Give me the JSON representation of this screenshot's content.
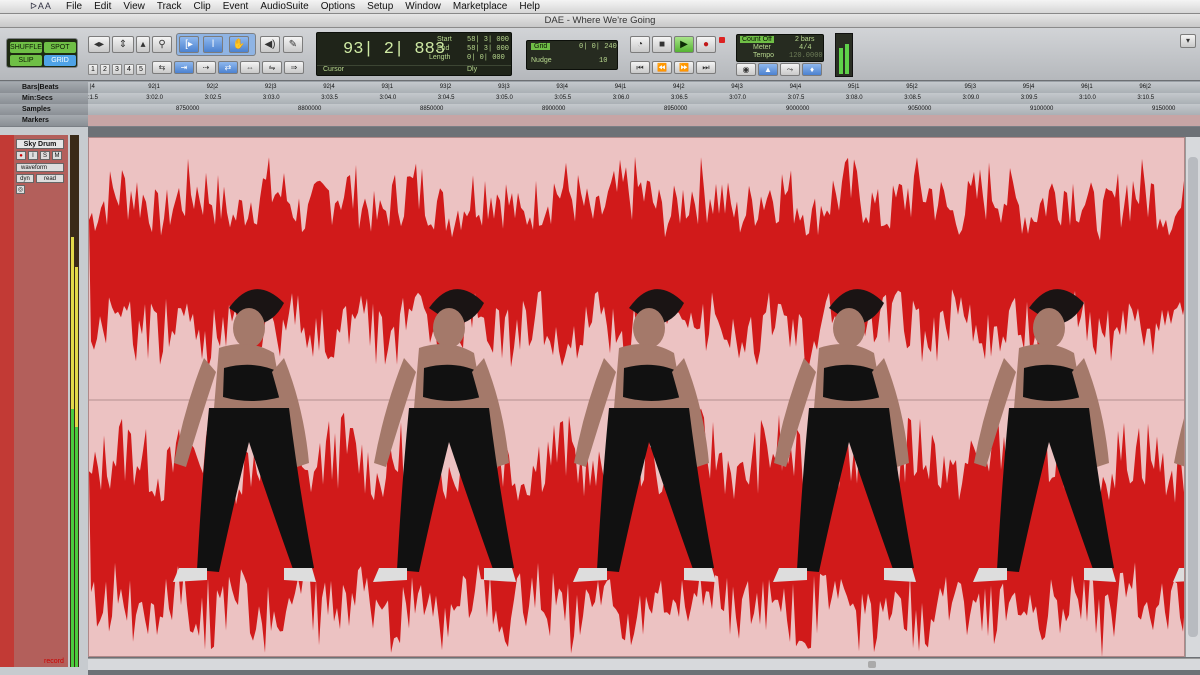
{
  "menubar": {
    "logo": "ᐅAA",
    "items": [
      "File",
      "Edit",
      "View",
      "Track",
      "Clip",
      "Event",
      "AudioSuite",
      "Options",
      "Setup",
      "Window",
      "Marketplace",
      "Help"
    ]
  },
  "window": {
    "title": "DAE - Where We're Going"
  },
  "edit_modes": {
    "shuffle": "SHUFFLE",
    "spot": "SPOT",
    "slip": "SLIP",
    "grid": "GRID"
  },
  "zoom_presets": [
    "1",
    "2",
    "3",
    "4",
    "5"
  ],
  "counter": {
    "main": "93| 2| 883",
    "start_label": "Start",
    "start_value": "58| 3| 000",
    "end_label": "End",
    "end_value": "58| 3| 000",
    "length_label": "Length",
    "length_value": "0| 0| 000",
    "cursor_label": "Cursor",
    "dly_label": "Dly"
  },
  "grid": {
    "grid_label": "Grid",
    "grid_value": "0| 0| 240",
    "nudge_label": "Nudge",
    "nudge_value": "10"
  },
  "midi": {
    "count_off": "Count Off",
    "count_off_value": "2 bars",
    "meter": "Meter",
    "meter_value": "4/4",
    "tempo": "Tempo",
    "tempo_value": "120.0000"
  },
  "rulers": {
    "bars_label": "Bars|Beats",
    "minsecs_label": "Min:Secs",
    "samples_label": "Samples",
    "markers_label": "Markers",
    "bars_ticks": [
      "|4",
      "92|1",
      "92|2",
      "92|3",
      "92|4",
      "93|1",
      "93|2",
      "93|3",
      "93|4",
      "94|1",
      "94|2",
      "94|3",
      "94|4",
      "95|1",
      "95|2",
      "95|3",
      "95|4",
      "96|1",
      "96|2"
    ],
    "min_ticks": [
      ":1.5",
      "3:02.0",
      "3:02.5",
      "3:03.0",
      "3:03.5",
      "3:04.0",
      "3:04.5",
      "3:05.0",
      "3:05.5",
      "3:06.0",
      "3:06.5",
      "3:07.0",
      "3:07.5",
      "3:08.0",
      "3:08.5",
      "3:09.0",
      "3:09.5",
      "3:10.0",
      "3:10.5"
    ],
    "sample_ticks": [
      "8750000",
      "8800000",
      "8850000",
      "8900000",
      "8950000",
      "9000000",
      "9050000",
      "9100000",
      "9150000"
    ]
  },
  "track": {
    "name": "Sky Drum",
    "view": "waveform",
    "dyn": "dyn",
    "automation": "read",
    "footer": "record"
  },
  "colors": {
    "waveform": "#d11a1a",
    "clip_bg": "#ecc2c2",
    "track": "#c23a35"
  }
}
